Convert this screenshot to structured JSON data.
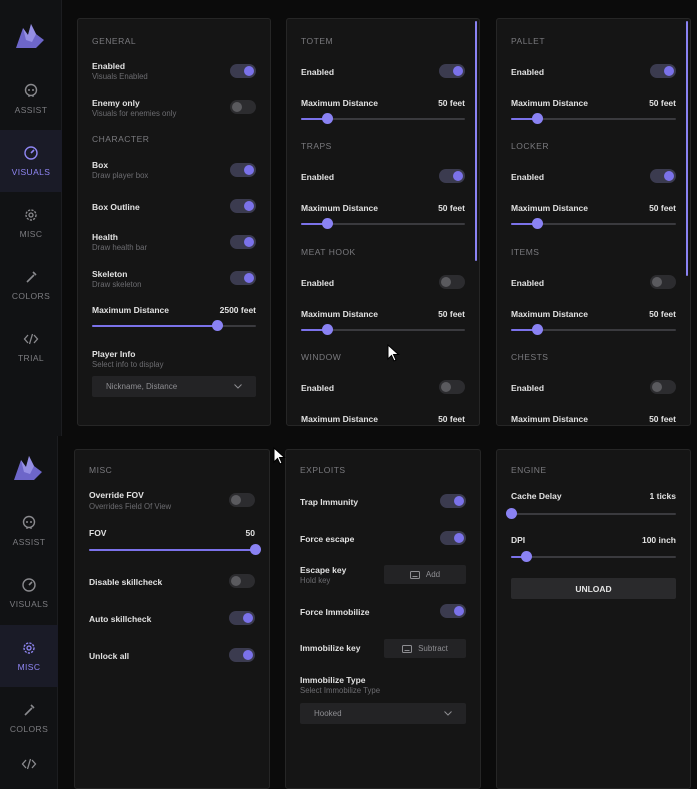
{
  "colors": {
    "accent": "#7b72ea",
    "panel": "#151515",
    "sidebar": "#111214"
  },
  "nav": {
    "assist": "ASSIST",
    "visuals": "VISUALS",
    "misc": "MISC",
    "colors": "COLORS",
    "trial": "TRIAL"
  },
  "top": {
    "general": {
      "title": "GENERAL",
      "enabled_label": "Enabled",
      "enabled_sub": "Visuals Enabled",
      "enabled_on": true,
      "enemy_label": "Enemy only",
      "enemy_sub": "Visuals for enemies only",
      "enemy_on": false,
      "character_title": "CHARACTER",
      "box_label": "Box",
      "box_sub": "Draw player box",
      "box_on": true,
      "outline_label": "Box Outline",
      "outline_on": true,
      "health_label": "Health",
      "health_sub": "Draw health bar",
      "health_on": true,
      "skeleton_label": "Skeleton",
      "skeleton_sub": "Draw skeleton",
      "skeleton_on": true,
      "maxdist_label": "Maximum Distance",
      "maxdist_value": "2500 feet",
      "maxdist_fraction": 0.76,
      "playerinfo_label": "Player Info",
      "playerinfo_sub": "Select info to display",
      "playerinfo_selected": "Nickname, Distance"
    },
    "middle": {
      "totem_title": "TOTEM",
      "totem_enabled_label": "Enabled",
      "totem_on": true,
      "totem_dist_label": "Maximum Distance",
      "totem_dist_value": "50 feet",
      "totem_frac": 0.16,
      "traps_title": "TRAPS",
      "traps_enabled_label": "Enabled",
      "traps_on": true,
      "traps_dist_label": "Maximum Distance",
      "traps_dist_value": "50 feet",
      "traps_frac": 0.16,
      "hook_title": "MEAT HOOK",
      "hook_enabled_label": "Enabled",
      "hook_on": false,
      "hook_dist_label": "Maximum Distance",
      "hook_dist_value": "50 feet",
      "hook_frac": 0.16,
      "window_title": "WINDOW",
      "window_enabled_label": "Enabled",
      "window_on": false,
      "window_dist_label": "Maximum Distance",
      "window_dist_value": "50 feet"
    },
    "right": {
      "pallet_title": "PALLET",
      "pallet_enabled_label": "Enabled",
      "pallet_on": true,
      "pallet_dist_label": "Maximum Distance",
      "pallet_dist_value": "50 feet",
      "pallet_frac": 0.16,
      "locker_title": "LOCKER",
      "locker_enabled_label": "Enabled",
      "locker_on": true,
      "locker_dist_label": "Maximum Distance",
      "locker_dist_value": "50 feet",
      "locker_frac": 0.16,
      "items_title": "ITEMS",
      "items_enabled_label": "Enabled",
      "items_on": false,
      "items_dist_label": "Maximum Distance",
      "items_dist_value": "50 feet",
      "items_frac": 0.16,
      "chests_title": "CHESTS",
      "chests_enabled_label": "Enabled",
      "chests_on": false,
      "chests_dist_label": "Maximum Distance",
      "chests_dist_value": "50 feet"
    }
  },
  "bottom": {
    "misc": {
      "title": "MISC",
      "fov_override_label": "Override FOV",
      "fov_override_sub": "Overrides Field Of View",
      "fov_override_on": false,
      "fov_label": "FOV",
      "fov_value": "50",
      "fov_frac": 1.0,
      "skill_disable_label": "Disable skillcheck",
      "skill_disable_on": false,
      "skill_auto_label": "Auto skillcheck",
      "skill_auto_on": true,
      "unlock_label": "Unlock all",
      "unlock_on": true
    },
    "exploits": {
      "title": "EXPLOITS",
      "trap_label": "Trap Immunity",
      "trap_on": true,
      "escape_label": "Force escape",
      "escape_on": true,
      "escape_key_label": "Escape key",
      "escape_key_sub": "Hold key",
      "escape_key_value": "Add",
      "immobilize_label": "Force Immobilize",
      "immobilize_on": true,
      "immobilize_key_label": "Immobilize key",
      "immobilize_key_value": "Subtract",
      "immobilize_type_label": "Immobilize Type",
      "immobilize_type_sub": "Select Immobilize Type",
      "immobilize_type_selected": "Hooked"
    },
    "engine": {
      "title": "ENGINE",
      "cache_label": "Cache Delay",
      "cache_value": "1 ticks",
      "cache_frac": 0.0,
      "dpi_label": "DPI",
      "dpi_value": "100 inch",
      "dpi_frac": 0.09,
      "unload_label": "UNLOAD"
    }
  }
}
